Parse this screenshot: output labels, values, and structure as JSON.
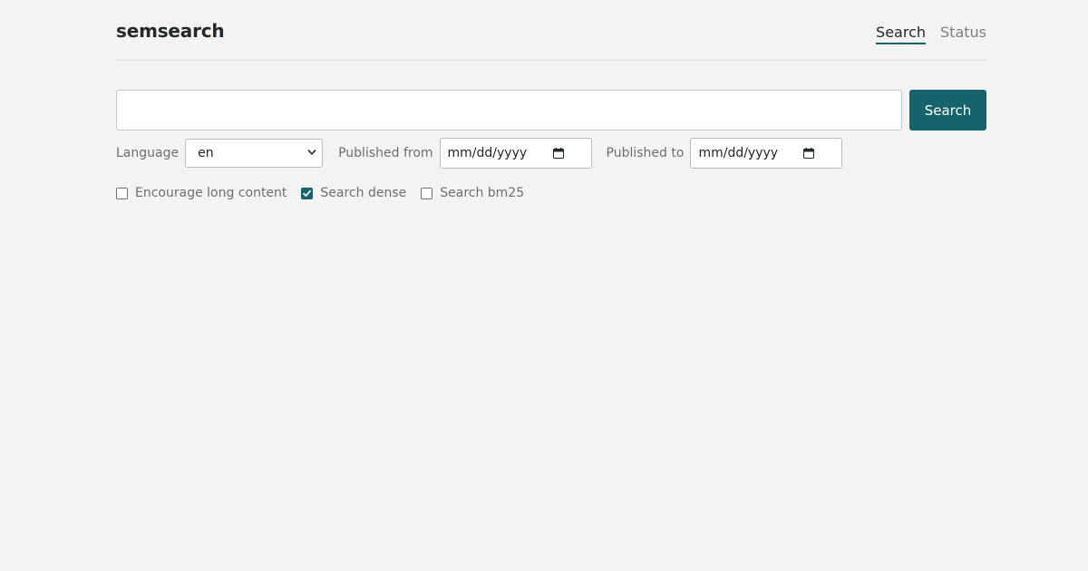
{
  "header": {
    "brand": "semsearch",
    "nav": [
      {
        "label": "Search",
        "active": true
      },
      {
        "label": "Status",
        "active": false
      }
    ]
  },
  "search": {
    "value": "",
    "placeholder": "",
    "button_label": "Search"
  },
  "filters": {
    "language": {
      "label": "Language",
      "value": "en"
    },
    "published_from": {
      "label": "Published from",
      "value": "mm/dd/yyyy"
    },
    "published_to": {
      "label": "Published to",
      "value": "mm/dd/yyyy"
    }
  },
  "options": [
    {
      "label": "Encourage long content",
      "checked": false
    },
    {
      "label": "Search dense",
      "checked": true
    },
    {
      "label": "Search bm25",
      "checked": false
    }
  ],
  "icons": {
    "language_select": "chevron-down-icon",
    "date_picker": "calendar-icon",
    "checkbox_mark": "checkmark-icon"
  },
  "colors": {
    "accent": "#17636c",
    "background": "#f2f3f2",
    "text_dark": "#22282b",
    "text_muted": "#6a6f72"
  }
}
